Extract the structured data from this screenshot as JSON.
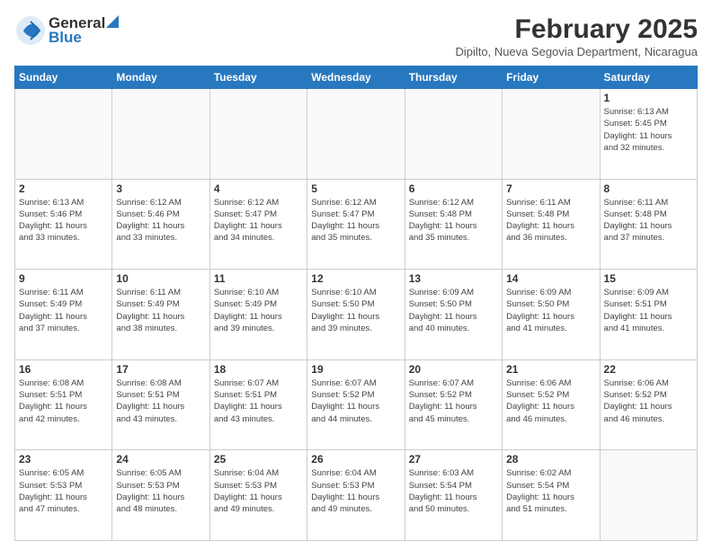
{
  "header": {
    "logo_general": "General",
    "logo_blue": "Blue",
    "month_title": "February 2025",
    "location": "Dipilto, Nueva Segovia Department, Nicaragua"
  },
  "weekdays": [
    "Sunday",
    "Monday",
    "Tuesday",
    "Wednesday",
    "Thursday",
    "Friday",
    "Saturday"
  ],
  "weeks": [
    [
      {
        "day": "",
        "info": ""
      },
      {
        "day": "",
        "info": ""
      },
      {
        "day": "",
        "info": ""
      },
      {
        "day": "",
        "info": ""
      },
      {
        "day": "",
        "info": ""
      },
      {
        "day": "",
        "info": ""
      },
      {
        "day": "1",
        "info": "Sunrise: 6:13 AM\nSunset: 5:45 PM\nDaylight: 11 hours\nand 32 minutes."
      }
    ],
    [
      {
        "day": "2",
        "info": "Sunrise: 6:13 AM\nSunset: 5:46 PM\nDaylight: 11 hours\nand 33 minutes."
      },
      {
        "day": "3",
        "info": "Sunrise: 6:12 AM\nSunset: 5:46 PM\nDaylight: 11 hours\nand 33 minutes."
      },
      {
        "day": "4",
        "info": "Sunrise: 6:12 AM\nSunset: 5:47 PM\nDaylight: 11 hours\nand 34 minutes."
      },
      {
        "day": "5",
        "info": "Sunrise: 6:12 AM\nSunset: 5:47 PM\nDaylight: 11 hours\nand 35 minutes."
      },
      {
        "day": "6",
        "info": "Sunrise: 6:12 AM\nSunset: 5:48 PM\nDaylight: 11 hours\nand 35 minutes."
      },
      {
        "day": "7",
        "info": "Sunrise: 6:11 AM\nSunset: 5:48 PM\nDaylight: 11 hours\nand 36 minutes."
      },
      {
        "day": "8",
        "info": "Sunrise: 6:11 AM\nSunset: 5:48 PM\nDaylight: 11 hours\nand 37 minutes."
      }
    ],
    [
      {
        "day": "9",
        "info": "Sunrise: 6:11 AM\nSunset: 5:49 PM\nDaylight: 11 hours\nand 37 minutes."
      },
      {
        "day": "10",
        "info": "Sunrise: 6:11 AM\nSunset: 5:49 PM\nDaylight: 11 hours\nand 38 minutes."
      },
      {
        "day": "11",
        "info": "Sunrise: 6:10 AM\nSunset: 5:49 PM\nDaylight: 11 hours\nand 39 minutes."
      },
      {
        "day": "12",
        "info": "Sunrise: 6:10 AM\nSunset: 5:50 PM\nDaylight: 11 hours\nand 39 minutes."
      },
      {
        "day": "13",
        "info": "Sunrise: 6:09 AM\nSunset: 5:50 PM\nDaylight: 11 hours\nand 40 minutes."
      },
      {
        "day": "14",
        "info": "Sunrise: 6:09 AM\nSunset: 5:50 PM\nDaylight: 11 hours\nand 41 minutes."
      },
      {
        "day": "15",
        "info": "Sunrise: 6:09 AM\nSunset: 5:51 PM\nDaylight: 11 hours\nand 41 minutes."
      }
    ],
    [
      {
        "day": "16",
        "info": "Sunrise: 6:08 AM\nSunset: 5:51 PM\nDaylight: 11 hours\nand 42 minutes."
      },
      {
        "day": "17",
        "info": "Sunrise: 6:08 AM\nSunset: 5:51 PM\nDaylight: 11 hours\nand 43 minutes."
      },
      {
        "day": "18",
        "info": "Sunrise: 6:07 AM\nSunset: 5:51 PM\nDaylight: 11 hours\nand 43 minutes."
      },
      {
        "day": "19",
        "info": "Sunrise: 6:07 AM\nSunset: 5:52 PM\nDaylight: 11 hours\nand 44 minutes."
      },
      {
        "day": "20",
        "info": "Sunrise: 6:07 AM\nSunset: 5:52 PM\nDaylight: 11 hours\nand 45 minutes."
      },
      {
        "day": "21",
        "info": "Sunrise: 6:06 AM\nSunset: 5:52 PM\nDaylight: 11 hours\nand 46 minutes."
      },
      {
        "day": "22",
        "info": "Sunrise: 6:06 AM\nSunset: 5:52 PM\nDaylight: 11 hours\nand 46 minutes."
      }
    ],
    [
      {
        "day": "23",
        "info": "Sunrise: 6:05 AM\nSunset: 5:53 PM\nDaylight: 11 hours\nand 47 minutes."
      },
      {
        "day": "24",
        "info": "Sunrise: 6:05 AM\nSunset: 5:53 PM\nDaylight: 11 hours\nand 48 minutes."
      },
      {
        "day": "25",
        "info": "Sunrise: 6:04 AM\nSunset: 5:53 PM\nDaylight: 11 hours\nand 49 minutes."
      },
      {
        "day": "26",
        "info": "Sunrise: 6:04 AM\nSunset: 5:53 PM\nDaylight: 11 hours\nand 49 minutes."
      },
      {
        "day": "27",
        "info": "Sunrise: 6:03 AM\nSunset: 5:54 PM\nDaylight: 11 hours\nand 50 minutes."
      },
      {
        "day": "28",
        "info": "Sunrise: 6:02 AM\nSunset: 5:54 PM\nDaylight: 11 hours\nand 51 minutes."
      },
      {
        "day": "",
        "info": ""
      }
    ]
  ]
}
